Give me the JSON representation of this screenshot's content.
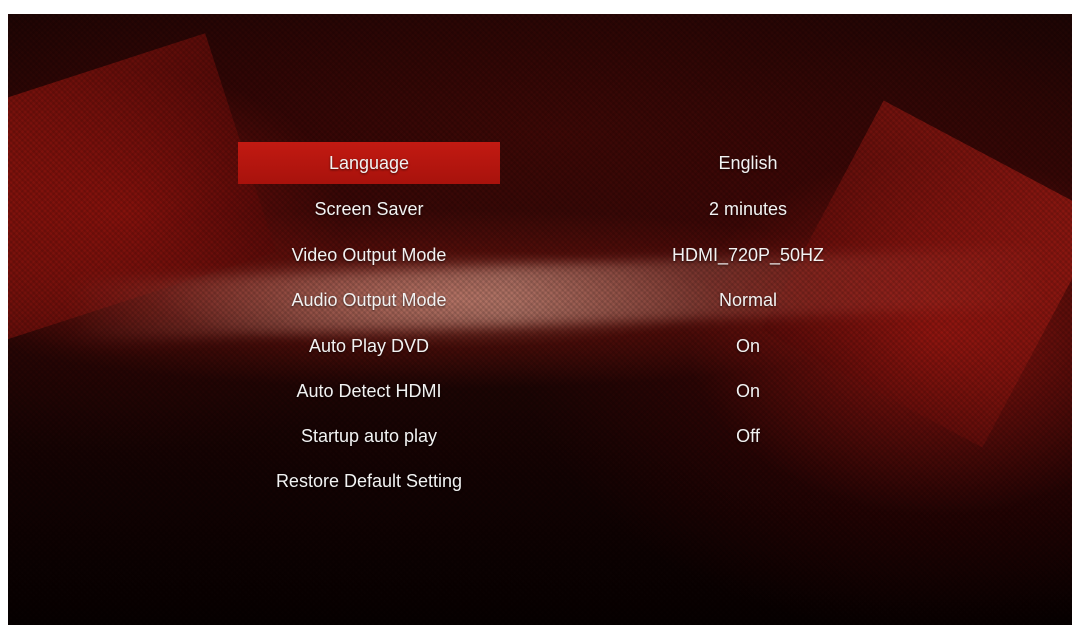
{
  "colors": {
    "selection": "#b3140e",
    "text": "#f2f2f2",
    "background": "#1a0504"
  },
  "settings_menu": {
    "selected_index": 0,
    "items": [
      {
        "label": "Language",
        "value": "English"
      },
      {
        "label": "Screen Saver",
        "value": "2 minutes"
      },
      {
        "label": "Video Output Mode",
        "value": "HDMI_720P_50HZ"
      },
      {
        "label": "Audio Output Mode",
        "value": "Normal"
      },
      {
        "label": "Auto Play DVD",
        "value": "On"
      },
      {
        "label": "Auto Detect HDMI",
        "value": "On"
      },
      {
        "label": "Startup auto play",
        "value": "Off"
      },
      {
        "label": "Restore Default Setting",
        "value": ""
      }
    ]
  }
}
